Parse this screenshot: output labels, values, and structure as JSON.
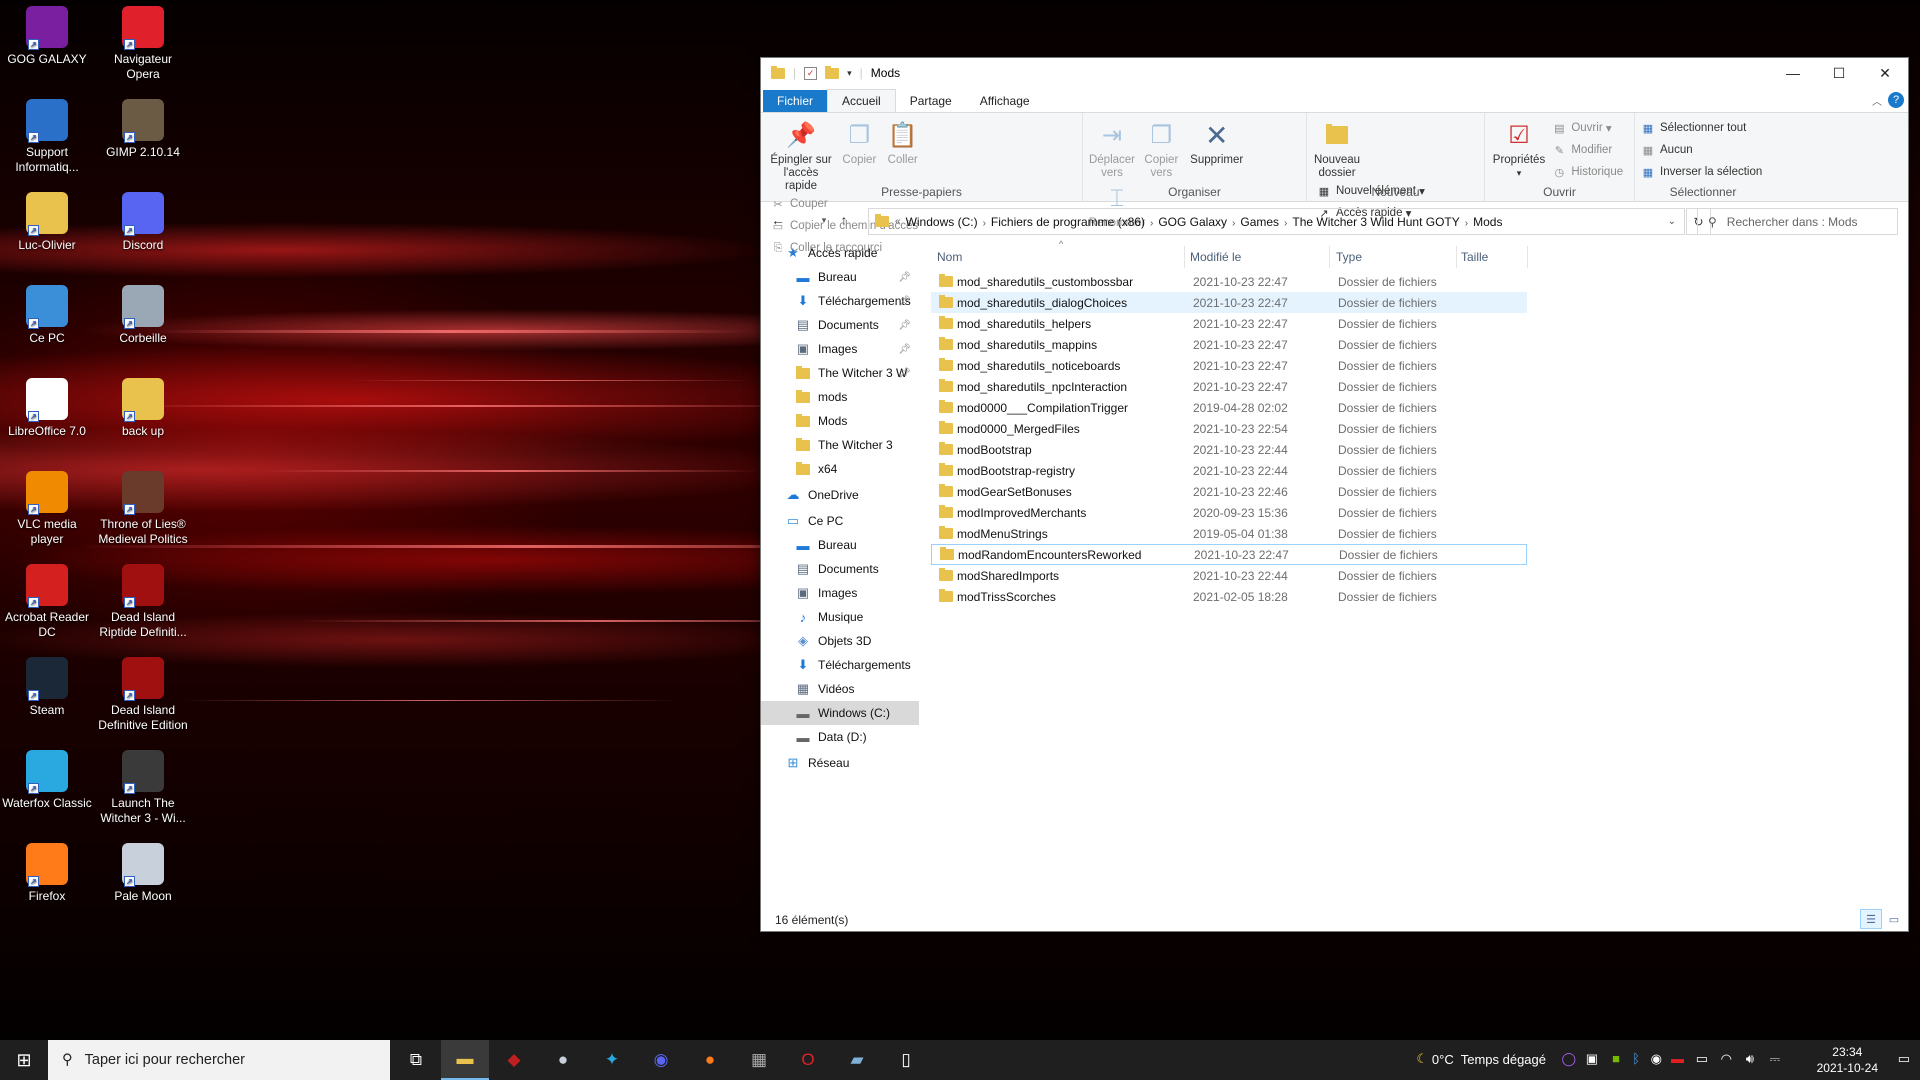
{
  "desktop_icons": [
    {
      "label": "GOG GALAXY",
      "icon": "gog-galaxy-icon",
      "color": "#7a1fa0"
    },
    {
      "label": "Navigateur Opera",
      "icon": "opera-icon",
      "color": "#e0202a"
    },
    {
      "label": "Support Informatiq...",
      "icon": "support-icon",
      "color": "#2a70c8"
    },
    {
      "label": "GIMP 2.10.14",
      "icon": "gimp-icon",
      "color": "#6b5a44"
    },
    {
      "label": "Luc-Olivier",
      "icon": "user-folder-icon",
      "color": "#e8c24c"
    },
    {
      "label": "Discord",
      "icon": "discord-icon",
      "color": "#5865f2"
    },
    {
      "label": "Ce PC",
      "icon": "computer-icon",
      "color": "#3a8fd8"
    },
    {
      "label": "Corbeille",
      "icon": "recycle-bin-icon",
      "color": "#9aa7b4"
    },
    {
      "label": "LibreOffice 7.0",
      "icon": "document-icon",
      "color": "#ffffff"
    },
    {
      "label": "back up",
      "icon": "folder-icon",
      "color": "#e8c24c"
    },
    {
      "label": "VLC media player",
      "icon": "vlc-icon",
      "color": "#f08a00"
    },
    {
      "label": "Throne of Lies® Medieval Politics",
      "icon": "throne-of-lies-icon",
      "color": "#6a3a2a"
    },
    {
      "label": "Acrobat Reader DC",
      "icon": "acrobat-icon",
      "color": "#d4201f"
    },
    {
      "label": "Dead Island Riptide Definiti...",
      "icon": "dead-island-riptide-icon",
      "color": "#a01010"
    },
    {
      "label": "Steam",
      "icon": "steam-icon",
      "color": "#1b2838"
    },
    {
      "label": "Dead Island Definitive Edition",
      "icon": "dead-island-icon",
      "color": "#a01010"
    },
    {
      "label": "Waterfox Classic",
      "icon": "waterfox-icon",
      "color": "#2aa8e0"
    },
    {
      "label": "Launch The Witcher 3 - Wi...",
      "icon": "witcher-icon",
      "color": "#3a3a3a"
    },
    {
      "label": "Firefox",
      "icon": "firefox-icon",
      "color": "#ff7a18"
    },
    {
      "label": "Pale Moon",
      "icon": "pale-moon-icon",
      "color": "#c8d0dc"
    }
  ],
  "window": {
    "title": "Mods",
    "tabs": {
      "file": "Fichier",
      "home": "Accueil",
      "share": "Partage",
      "view": "Affichage"
    },
    "ribbon": {
      "clipboard": {
        "label": "Presse-papiers",
        "pin": "Épingler sur l'accès rapide",
        "copy": "Copier",
        "paste": "Coller",
        "cut": "Couper",
        "copy_path": "Copier le chemin d'accès",
        "paste_shortcut": "Coller le raccourci"
      },
      "organize": {
        "label": "Organiser",
        "move": "Déplacer vers",
        "copy_to": "Copier vers",
        "delete": "Supprimer",
        "rename": "Renommer"
      },
      "new": {
        "label": "Nouveau",
        "new_folder": "Nouveau dossier",
        "new_item": "Nouvel élément",
        "easy_access": "Accès rapide"
      },
      "open": {
        "label": "Ouvrir",
        "properties": "Propriétés",
        "open": "Ouvrir",
        "edit": "Modifier",
        "history": "Historique"
      },
      "select": {
        "label": "Sélectionner",
        "select_all": "Sélectionner tout",
        "select_none": "Aucun",
        "invert": "Inverser la sélection"
      }
    },
    "path": [
      "Windows (C:)",
      "Fichiers de programme (x86)",
      "GOG Galaxy",
      "Games",
      "The Witcher 3 Wild Hunt GOTY",
      "Mods"
    ],
    "path_overflow": "«",
    "search_placeholder": "Rechercher dans : Mods",
    "nav": [
      {
        "label": "Accès rapide",
        "icon": "star-icon",
        "level": 0,
        "pin": false
      },
      {
        "label": "Bureau",
        "icon": "desktop-icon",
        "level": 1,
        "pin": true
      },
      {
        "label": "Téléchargements",
        "icon": "download-icon",
        "level": 1,
        "pin": true
      },
      {
        "label": "Documents",
        "icon": "documents-icon",
        "level": 1,
        "pin": true
      },
      {
        "label": "Images",
        "icon": "images-icon",
        "level": 1,
        "pin": true
      },
      {
        "label": "The Witcher 3 W",
        "icon": "folder-icon",
        "level": 1,
        "pin": true
      },
      {
        "label": "mods",
        "icon": "folder-icon",
        "level": 1,
        "pin": false
      },
      {
        "label": "Mods",
        "icon": "folder-icon",
        "level": 1,
        "pin": false
      },
      {
        "label": "The Witcher 3",
        "icon": "folder-icon",
        "level": 1,
        "pin": false
      },
      {
        "label": "x64",
        "icon": "folder-icon",
        "level": 1,
        "pin": false
      },
      {
        "label": "OneDrive",
        "icon": "cloud-icon",
        "level": 0,
        "pin": false,
        "gap": true
      },
      {
        "label": "Ce PC",
        "icon": "computer-icon",
        "level": 0,
        "pin": false,
        "gap": true
      },
      {
        "label": "Bureau",
        "icon": "desktop-icon",
        "level": 1,
        "pin": false
      },
      {
        "label": "Documents",
        "icon": "documents-icon",
        "level": 1,
        "pin": false
      },
      {
        "label": "Images",
        "icon": "images-icon",
        "level": 1,
        "pin": false
      },
      {
        "label": "Musique",
        "icon": "music-icon",
        "level": 1,
        "pin": false
      },
      {
        "label": "Objets 3D",
        "icon": "cube-icon",
        "level": 1,
        "pin": false
      },
      {
        "label": "Téléchargements",
        "icon": "download-icon",
        "level": 1,
        "pin": false
      },
      {
        "label": "Vidéos",
        "icon": "video-icon",
        "level": 1,
        "pin": false
      },
      {
        "label": "Windows (C:)",
        "icon": "drive-icon",
        "level": 1,
        "pin": false,
        "selected": true
      },
      {
        "label": "Data (D:)",
        "icon": "drive-icon",
        "level": 1,
        "pin": false
      },
      {
        "label": "Réseau",
        "icon": "network-icon",
        "level": 0,
        "pin": false,
        "gap": true
      }
    ],
    "columns": {
      "name": "Nom",
      "modified": "Modifié le",
      "type": "Type",
      "size": "Taille"
    },
    "files": [
      {
        "name": "mod_sharedutils_custombossbar",
        "date": "2021-10-23 22:47",
        "type": "Dossier de fichiers"
      },
      {
        "name": "mod_sharedutils_dialogChoices",
        "date": "2021-10-23 22:47",
        "type": "Dossier de fichiers",
        "hover": true
      },
      {
        "name": "mod_sharedutils_helpers",
        "date": "2021-10-23 22:47",
        "type": "Dossier de fichiers"
      },
      {
        "name": "mod_sharedutils_mappins",
        "date": "2021-10-23 22:47",
        "type": "Dossier de fichiers"
      },
      {
        "name": "mod_sharedutils_noticeboards",
        "date": "2021-10-23 22:47",
        "type": "Dossier de fichiers"
      },
      {
        "name": "mod_sharedutils_npcInteraction",
        "date": "2021-10-23 22:47",
        "type": "Dossier de fichiers"
      },
      {
        "name": "mod0000___CompilationTrigger",
        "date": "2019-04-28 02:02",
        "type": "Dossier de fichiers"
      },
      {
        "name": "mod0000_MergedFiles",
        "date": "2021-10-23 22:54",
        "type": "Dossier de fichiers"
      },
      {
        "name": "modBootstrap",
        "date": "2021-10-23 22:44",
        "type": "Dossier de fichiers"
      },
      {
        "name": "modBootstrap-registry",
        "date": "2021-10-23 22:44",
        "type": "Dossier de fichiers"
      },
      {
        "name": "modGearSetBonuses",
        "date": "2021-10-23 22:46",
        "type": "Dossier de fichiers"
      },
      {
        "name": "modImprovedMerchants",
        "date": "2020-09-23 15:36",
        "type": "Dossier de fichiers"
      },
      {
        "name": "modMenuStrings",
        "date": "2019-05-04 01:38",
        "type": "Dossier de fichiers"
      },
      {
        "name": "modRandomEncountersReworked",
        "date": "2021-10-23 22:47",
        "type": "Dossier de fichiers",
        "focus": true
      },
      {
        "name": "modSharedImports",
        "date": "2021-10-23 22:44",
        "type": "Dossier de fichiers"
      },
      {
        "name": "modTrissScorches",
        "date": "2021-02-05 18:28",
        "type": "Dossier de fichiers"
      }
    ],
    "status": "16 élément(s)"
  },
  "taskbar": {
    "search_placeholder": "Taper ici pour rechercher",
    "apps": [
      "task-view-icon",
      "file-explorer-icon",
      "gog-galaxy-icon",
      "pale-moon-icon",
      "waterfox-icon",
      "discord-icon",
      "firefox-icon",
      "calculator-icon",
      "opera-icon",
      "photos-icon",
      "libreoffice-icon"
    ],
    "weather": "0°C  Temps dégagé",
    "time": "23:34",
    "date": "2021-10-24"
  }
}
